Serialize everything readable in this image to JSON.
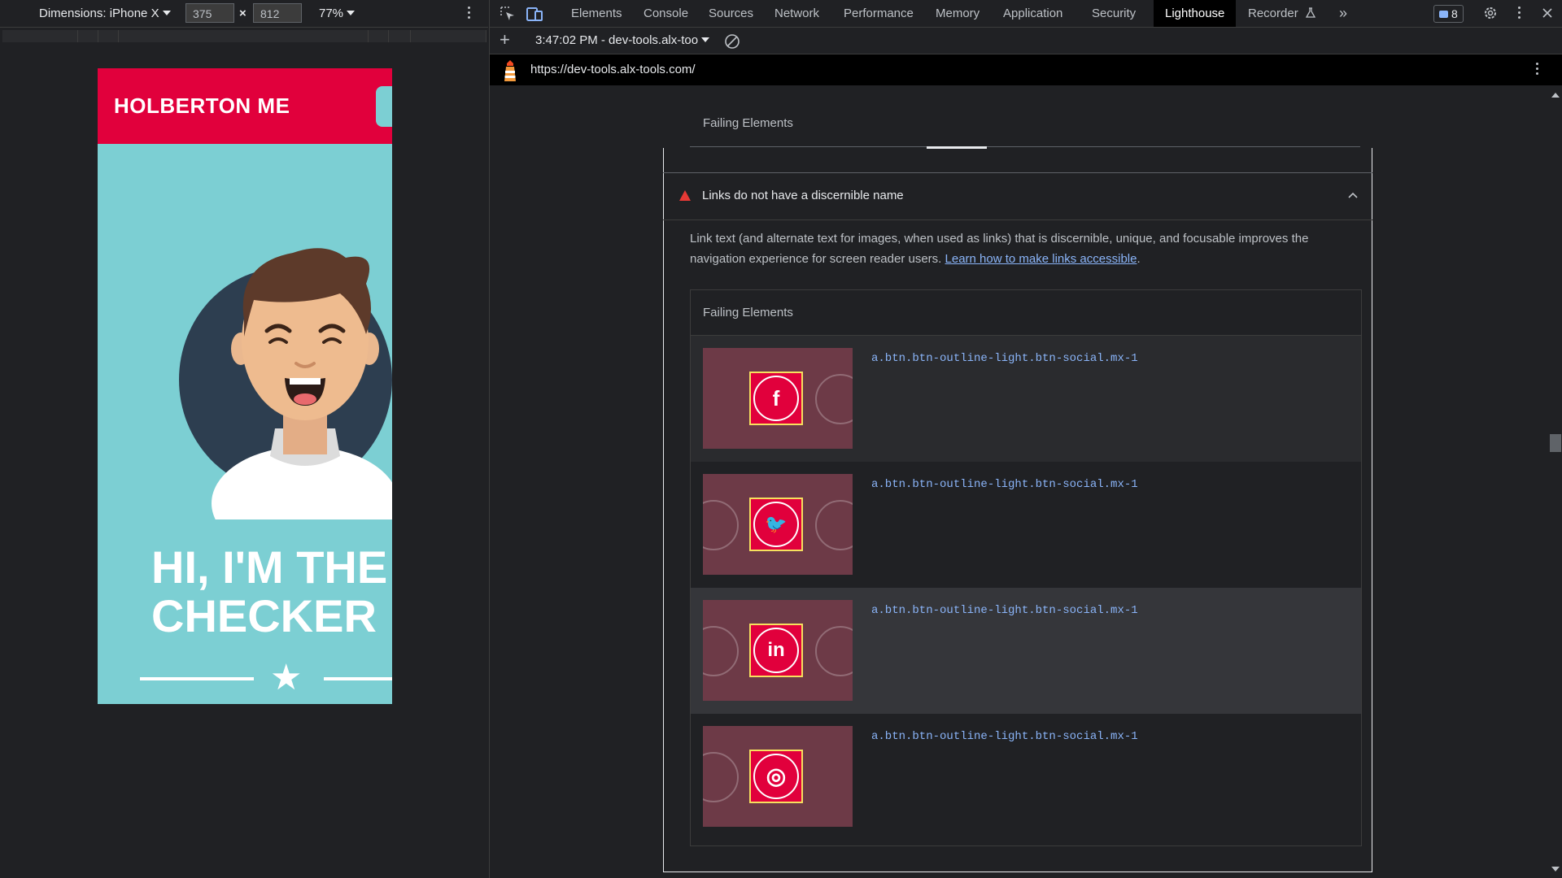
{
  "device_toolbar": {
    "dimensions_label": "Dimensions: iPhone X",
    "width": "375",
    "height": "812",
    "times": "×",
    "zoom": "77%"
  },
  "site": {
    "brand": "HOLBERTON ME",
    "hero_title": "HI, I'M THE\nCHECKER"
  },
  "devtools": {
    "tabs": [
      "Elements",
      "Console",
      "Sources",
      "Network",
      "Performance",
      "Memory",
      "Application",
      "Security",
      "Lighthouse",
      "Recorder"
    ],
    "active_tab": "Lighthouse",
    "more_tabs": "»",
    "issues_count": "8",
    "lighthouse_bar": {
      "add": "+",
      "report_label": "3:47:02 PM - dev-tools.alx-too"
    },
    "url": "https://dev-tools.alx-tools.com/",
    "report": {
      "failing_elements_top": "Failing Elements",
      "audit_title": "Links do not have a discernible name",
      "audit_description": "Link text (and alternate text for images, when used as links) that is discernible, unique, and focusable improves the navigation experience for screen reader users. ",
      "audit_link": "Learn how to make links accessible",
      "audit_period": ".",
      "table_header": "Failing Elements",
      "rows": [
        {
          "selector": "a.btn.btn-outline-light.btn-social.mx-1",
          "icon": "facebook-icon",
          "glyph": "f"
        },
        {
          "selector": "a.btn.btn-outline-light.btn-social.mx-1",
          "icon": "twitter-icon",
          "glyph": "🐦"
        },
        {
          "selector": "a.btn.btn-outline-light.btn-social.mx-1",
          "icon": "linkedin-icon",
          "glyph": "in"
        },
        {
          "selector": "a.btn.btn-outline-light.btn-social.mx-1",
          "icon": "dribbble-icon",
          "glyph": "◎"
        }
      ]
    }
  },
  "colors": {
    "brand_red": "#e1003c",
    "teal": "#7ccfd3",
    "devtools_bg": "#202124",
    "link_blue": "#8ab4f8",
    "fail_red": "#e53935",
    "focus_outline": "#f6e05e"
  }
}
